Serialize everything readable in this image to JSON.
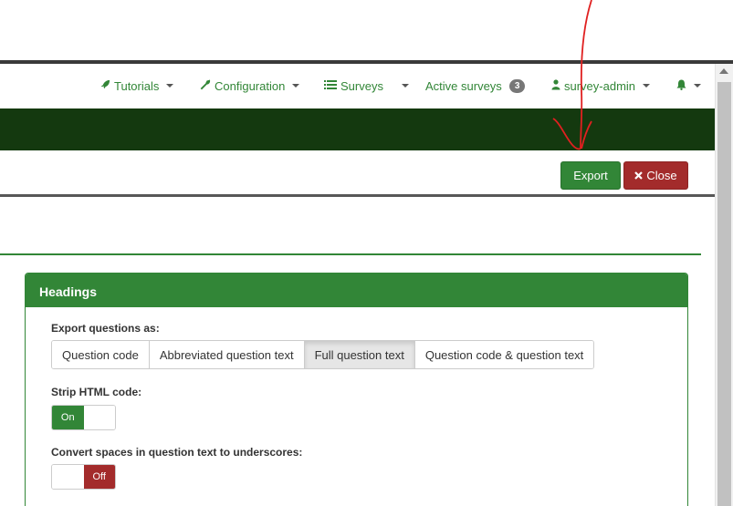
{
  "navbar": {
    "tutorials": "Tutorials",
    "configuration": "Configuration",
    "surveys": "Surveys",
    "active_surveys": "Active surveys",
    "active_count": "3",
    "user": "survey-admin"
  },
  "actions": {
    "export": "Export",
    "close": "Close"
  },
  "panel": {
    "title": "Headings",
    "export_label": "Export questions as:",
    "options": [
      "Question code",
      "Abbreviated question text",
      "Full question text",
      "Question code & question text"
    ],
    "selected": "Full question text",
    "strip_label": "Strip HTML code:",
    "strip_value": "On",
    "convert_label": "Convert spaces in question text to underscores:",
    "convert_value": "Off"
  },
  "colors": {
    "brand_green": "#328637",
    "dark_green": "#14390f",
    "danger_red": "#a32b2b",
    "annotation_red": "#e02020"
  },
  "icons": {
    "tutorials": "rocket-icon",
    "configuration": "wrench-icon",
    "surveys": "list-icon",
    "user": "user-icon",
    "notifications": "bell-icon",
    "close": "times-icon"
  }
}
